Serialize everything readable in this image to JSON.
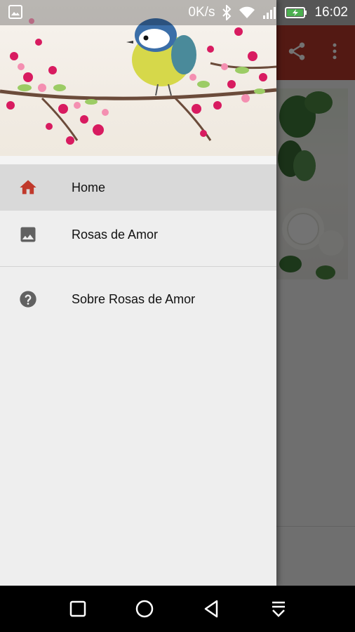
{
  "status_bar": {
    "network_speed": "0K/s",
    "time": "16:02",
    "icons": [
      "gallery-notification-icon",
      "bluetooth-icon",
      "wifi-icon",
      "signal-icon",
      "battery-charging-icon"
    ]
  },
  "app_toolbar": {
    "color": "#b8382c",
    "actions": [
      "share-icon",
      "more-vert-icon"
    ]
  },
  "drawer": {
    "header_image": "bird-on-blossom-branch",
    "items": [
      {
        "label": "Home",
        "icon": "home-icon",
        "selected": true,
        "icon_color": "#c0392b"
      },
      {
        "label": "Rosas de Amor",
        "icon": "image-icon",
        "selected": false,
        "icon_color": "#616161"
      },
      {
        "label": "Sobre Rosas de Amor",
        "icon": "help-icon",
        "selected": false,
        "icon_color": "#616161"
      }
    ]
  },
  "nav_bar": {
    "buttons": [
      "recents-button",
      "home-button",
      "back-button",
      "notifications-pull-button"
    ]
  }
}
